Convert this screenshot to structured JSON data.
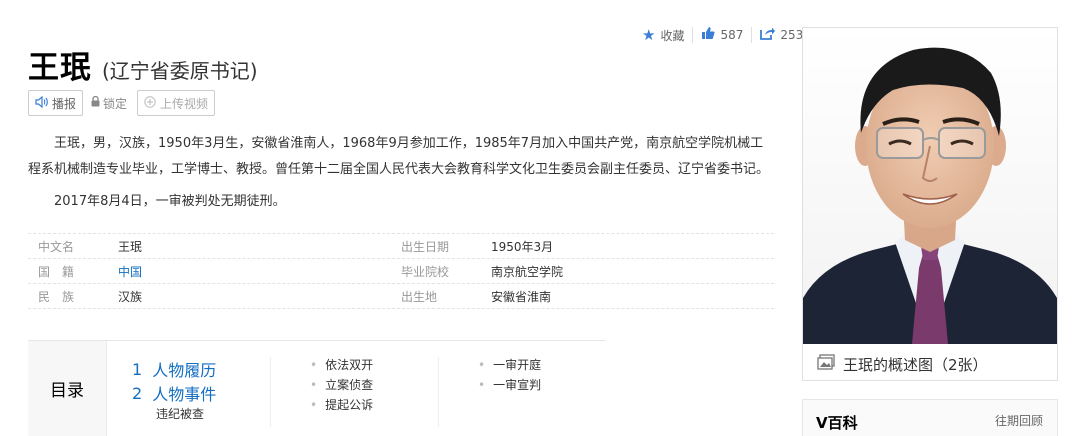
{
  "toolbar": {
    "favorite_label": "收藏",
    "like_count": "587",
    "share_count": "253"
  },
  "header": {
    "name": "王珉",
    "subtitle": "(辽宁省委原书记)"
  },
  "actions": {
    "broadcast_label": "播报",
    "lock_label": "锁定",
    "upload_label": "上传视频"
  },
  "summary": {
    "p1": "王珉，男，汉族，1950年3月生，安徽省淮南人，1968年9月参加工作，1985年7月加入中国共产党，南京航空学院机械工程系机械制造专业毕业，工学博士、教授。曾任第十二届全国人民代表大会教育科学文化卫生委员会副主任委员、辽宁省委书记。",
    "p2": "2017年8月4日，一审被判处无期徒刑。"
  },
  "info": [
    {
      "k1": "中文名",
      "v1": "王珉",
      "k2": "出生日期",
      "v2": "1950年3月"
    },
    {
      "k1": "国　籍",
      "v1": "中国",
      "k2": "毕业院校",
      "v2": "南京航空学院"
    },
    {
      "k1": "民　族",
      "v1": "汉族",
      "k2": "出生地",
      "v2": "安徽省淮南"
    }
  ],
  "toc": {
    "label": "目录",
    "items": [
      {
        "num": "1",
        "text": "人物履历"
      },
      {
        "num": "2",
        "text": "人物事件"
      }
    ],
    "sub_item": "违纪被查",
    "col2": [
      "依法双开",
      "立案侦查",
      "提起公诉"
    ],
    "col3": [
      "一审开庭",
      "一审宣判"
    ]
  },
  "sidebar": {
    "caption": "王珉的概述图（2张）"
  },
  "vbaike": {
    "title": "V百科",
    "link": "往期回顾"
  },
  "colors": {
    "accent": "#3a7fd5",
    "link": "#136ec2"
  }
}
